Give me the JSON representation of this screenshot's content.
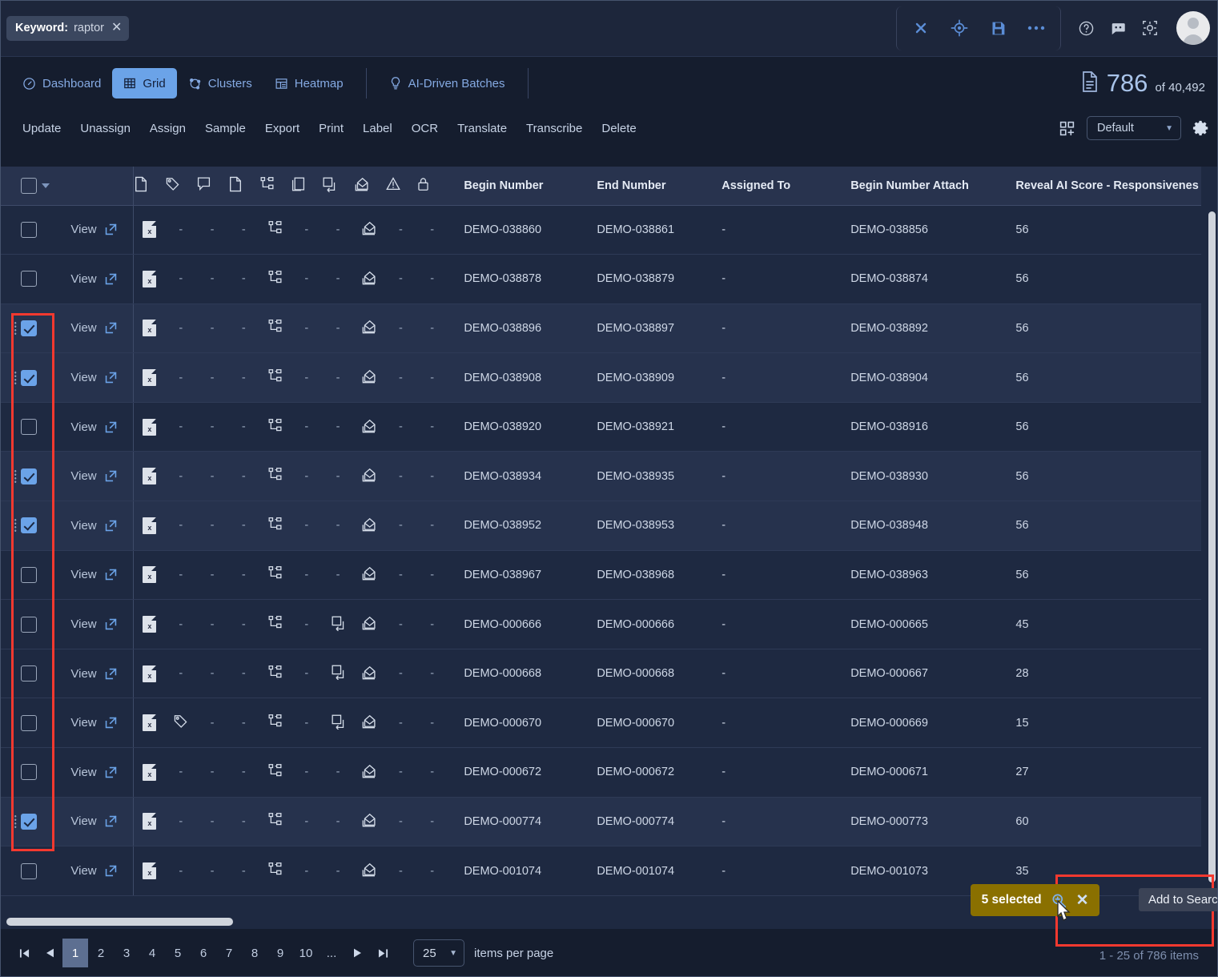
{
  "topbar": {
    "chip": {
      "label": "Keyword:",
      "value": "raptor",
      "close": "✕"
    },
    "tools": [
      {
        "name": "clear-search-button",
        "glyph": "clear"
      },
      {
        "name": "locate-button",
        "glyph": "target"
      },
      {
        "name": "save-search-button",
        "glyph": "save"
      },
      {
        "name": "more-options-button",
        "glyph": "ellipsis"
      }
    ],
    "right_icons": [
      {
        "name": "help-icon",
        "glyph": "question"
      },
      {
        "name": "feedback-icon",
        "glyph": "chat-face"
      },
      {
        "name": "theme-icon",
        "glyph": "brightness"
      }
    ]
  },
  "tabs": [
    {
      "label": "Dashboard",
      "icon": "dashboard-icon",
      "active": false
    },
    {
      "label": "Grid",
      "icon": "grid-icon",
      "active": true
    },
    {
      "label": "Clusters",
      "icon": "clusters-icon",
      "active": false
    },
    {
      "label": "Heatmap",
      "icon": "heatmap-icon",
      "active": false
    },
    {
      "label": "AI-Driven Batches",
      "icon": "bulb-icon",
      "active": false
    }
  ],
  "doc_count": {
    "icon": "document-icon",
    "current": "786",
    "of": "of 40,492"
  },
  "actions": [
    "Update",
    "Unassign",
    "Assign",
    "Sample",
    "Export",
    "Print",
    "Label",
    "OCR",
    "Translate",
    "Transcribe",
    "Delete"
  ],
  "toolbar_right": {
    "layout_icon": "add-layout-icon",
    "view_value": "Default",
    "settings_icon": "gear-icon"
  },
  "grid": {
    "icon_columns": [
      "document-icon",
      "tag-icon",
      "comment-icon",
      "page-icon",
      "family-icon",
      "duplicate-icon",
      "near-duplicate-icon",
      "email-icon",
      "warning-icon",
      "lock-icon"
    ],
    "text_columns": [
      "Begin Number",
      "End Number",
      "Assigned To",
      "Begin Number Attach",
      "Reveal AI Score - Responsivenes"
    ],
    "view_label": "View",
    "dash": "-",
    "rows": [
      {
        "selected": false,
        "xls": true,
        "tag": false,
        "family": true,
        "nearDup": false,
        "email": true,
        "begin": "DEMO-038860",
        "end": "DEMO-038861",
        "assigned": "-",
        "attach": "DEMO-038856",
        "score": "56"
      },
      {
        "selected": false,
        "xls": true,
        "tag": false,
        "family": true,
        "nearDup": false,
        "email": true,
        "begin": "DEMO-038878",
        "end": "DEMO-038879",
        "assigned": "-",
        "attach": "DEMO-038874",
        "score": "56"
      },
      {
        "selected": true,
        "xls": true,
        "tag": false,
        "family": true,
        "nearDup": false,
        "email": true,
        "begin": "DEMO-038896",
        "end": "DEMO-038897",
        "assigned": "-",
        "attach": "DEMO-038892",
        "score": "56"
      },
      {
        "selected": true,
        "xls": true,
        "tag": false,
        "family": true,
        "nearDup": false,
        "email": true,
        "begin": "DEMO-038908",
        "end": "DEMO-038909",
        "assigned": "-",
        "attach": "DEMO-038904",
        "score": "56"
      },
      {
        "selected": false,
        "xls": true,
        "tag": false,
        "family": true,
        "nearDup": false,
        "email": true,
        "begin": "DEMO-038920",
        "end": "DEMO-038921",
        "assigned": "-",
        "attach": "DEMO-038916",
        "score": "56"
      },
      {
        "selected": true,
        "xls": true,
        "tag": false,
        "family": true,
        "nearDup": false,
        "email": true,
        "begin": "DEMO-038934",
        "end": "DEMO-038935",
        "assigned": "-",
        "attach": "DEMO-038930",
        "score": "56"
      },
      {
        "selected": true,
        "xls": true,
        "tag": false,
        "family": true,
        "nearDup": false,
        "email": true,
        "begin": "DEMO-038952",
        "end": "DEMO-038953",
        "assigned": "-",
        "attach": "DEMO-038948",
        "score": "56"
      },
      {
        "selected": false,
        "xls": true,
        "tag": false,
        "family": true,
        "nearDup": false,
        "email": true,
        "begin": "DEMO-038967",
        "end": "DEMO-038968",
        "assigned": "-",
        "attach": "DEMO-038963",
        "score": "56"
      },
      {
        "selected": false,
        "xls": true,
        "tag": false,
        "family": true,
        "nearDup": true,
        "email": true,
        "begin": "DEMO-000666",
        "end": "DEMO-000666",
        "assigned": "-",
        "attach": "DEMO-000665",
        "score": "45"
      },
      {
        "selected": false,
        "xls": true,
        "tag": false,
        "family": true,
        "nearDup": true,
        "email": true,
        "begin": "DEMO-000668",
        "end": "DEMO-000668",
        "assigned": "-",
        "attach": "DEMO-000667",
        "score": "28"
      },
      {
        "selected": false,
        "xls": true,
        "tag": true,
        "family": true,
        "nearDup": true,
        "email": true,
        "begin": "DEMO-000670",
        "end": "DEMO-000670",
        "assigned": "-",
        "attach": "DEMO-000669",
        "score": "15"
      },
      {
        "selected": false,
        "xls": true,
        "tag": false,
        "family": true,
        "nearDup": false,
        "email": true,
        "begin": "DEMO-000672",
        "end": "DEMO-000672",
        "assigned": "-",
        "attach": "DEMO-000671",
        "score": "27"
      },
      {
        "selected": true,
        "xls": true,
        "tag": false,
        "family": true,
        "nearDup": false,
        "email": true,
        "begin": "DEMO-000774",
        "end": "DEMO-000774",
        "assigned": "-",
        "attach": "DEMO-000773",
        "score": "60"
      },
      {
        "selected": false,
        "xls": true,
        "tag": false,
        "family": true,
        "nearDup": false,
        "email": true,
        "begin": "DEMO-001074",
        "end": "DEMO-001074",
        "assigned": "-",
        "attach": "DEMO-001073",
        "score": "35"
      }
    ]
  },
  "selection_popup": {
    "label": "5 selected",
    "add_icon": "zoom-in-icon",
    "close": "✕",
    "tooltip": "Add to Search"
  },
  "pager": {
    "first": "⏮",
    "prev": "◀",
    "pages": [
      "1",
      "2",
      "3",
      "4",
      "5",
      "6",
      "7",
      "8",
      "9",
      "10",
      "..."
    ],
    "active_page": "1",
    "next": "▶",
    "last": "⏭",
    "per_page": "25",
    "per_page_label": "items per page",
    "items_info": "1 - 25 of 786 items"
  },
  "colors": {
    "accent": "#6ba3e8",
    "annotation": "#f4392f",
    "selection_badge": "#8a7000",
    "grid_bg": "#1e2941",
    "header_bg": "#28334e"
  }
}
